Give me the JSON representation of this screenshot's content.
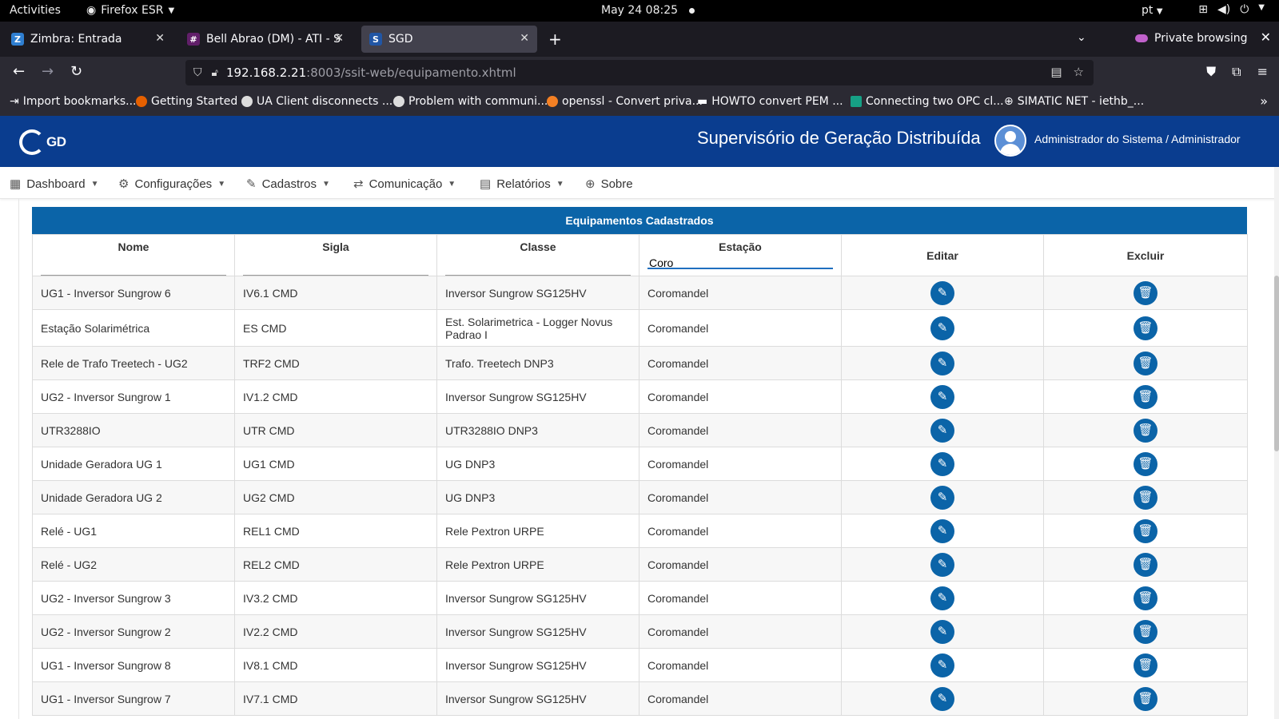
{
  "system": {
    "activities": "Activities",
    "app_name": "Firefox ESR",
    "clock": "May 24  08:25",
    "lang": "pt"
  },
  "tabs": [
    {
      "label": "Zimbra: Entrada",
      "icon": "Z",
      "color": "#2f7fd1"
    },
    {
      "label": "Bell Abrao (DM) - ATI - Sl",
      "icon": "#",
      "color": "#611f69"
    },
    {
      "label": "SGD",
      "icon": "S",
      "color": "#2156a5"
    }
  ],
  "private_label": "Private browsing",
  "url": {
    "host": "192.168.2.21",
    "path": ":8003/ssit-web/equipamento.xhtml"
  },
  "bookmarks": [
    "Import bookmarks...",
    "Getting Started",
    "UA Client disconnects ...",
    "Problem with communi...",
    "openssl - Convert priva...",
    "HOWTO convert PEM ...",
    "Connecting two OPC cl...",
    "SIMATIC NET - iethb_..."
  ],
  "app": {
    "logo": "GD",
    "title": "Supervisório de Geração Distribuída",
    "user": "Administrador do Sistema / Administrador",
    "brand_color": "#0a3d8f",
    "accent_color": "#0b64a8"
  },
  "menu": [
    {
      "label": "Dashboard",
      "icon": "dashboard-icon"
    },
    {
      "label": "Configurações",
      "icon": "gear-icon"
    },
    {
      "label": "Cadastros",
      "icon": "pencil-icon"
    },
    {
      "label": "Comunicação",
      "icon": "exchange-icon"
    },
    {
      "label": "Relatórios",
      "icon": "clipboard-icon"
    },
    {
      "label": "Sobre",
      "icon": "globe-icon"
    }
  ],
  "table": {
    "caption": "Equipamentos Cadastrados",
    "columns": [
      "Nome",
      "Sigla",
      "Classe",
      "Estação",
      "Editar",
      "Excluir"
    ],
    "filter_estacao": "Coro",
    "rows": [
      [
        "UG1 - Inversor Sungrow 6",
        "IV6.1 CMD",
        "Inversor Sungrow SG125HV",
        "Coromandel"
      ],
      [
        "Estação Solarimétrica",
        "ES CMD",
        "Est. Solarimetrica - Logger Novus Padrao I",
        "Coromandel"
      ],
      [
        "Rele de Trafo Treetech - UG2",
        "TRF2 CMD",
        "Trafo. Treetech DNP3",
        "Coromandel"
      ],
      [
        "UG2 - Inversor Sungrow 1",
        "IV1.2 CMD",
        "Inversor Sungrow SG125HV",
        "Coromandel"
      ],
      [
        "UTR3288IO",
        "UTR CMD",
        "UTR3288IO DNP3",
        "Coromandel"
      ],
      [
        "Unidade Geradora UG 1",
        "UG1 CMD",
        "UG DNP3",
        "Coromandel"
      ],
      [
        "Unidade Geradora UG 2",
        "UG2 CMD",
        "UG DNP3",
        "Coromandel"
      ],
      [
        "Relé - UG1",
        "REL1 CMD",
        "Rele Pextron URPE",
        "Coromandel"
      ],
      [
        "Relé - UG2",
        "REL2 CMD",
        "Rele Pextron URPE",
        "Coromandel"
      ],
      [
        "UG2 - Inversor Sungrow 3",
        "IV3.2 CMD",
        "Inversor Sungrow SG125HV",
        "Coromandel"
      ],
      [
        "UG2 - Inversor Sungrow 2",
        "IV2.2 CMD",
        "Inversor Sungrow SG125HV",
        "Coromandel"
      ],
      [
        "UG1 - Inversor Sungrow 8",
        "IV8.1 CMD",
        "Inversor Sungrow SG125HV",
        "Coromandel"
      ],
      [
        "UG1 - Inversor Sungrow 7",
        "IV7.1 CMD",
        "Inversor Sungrow SG125HV",
        "Coromandel"
      ]
    ]
  }
}
